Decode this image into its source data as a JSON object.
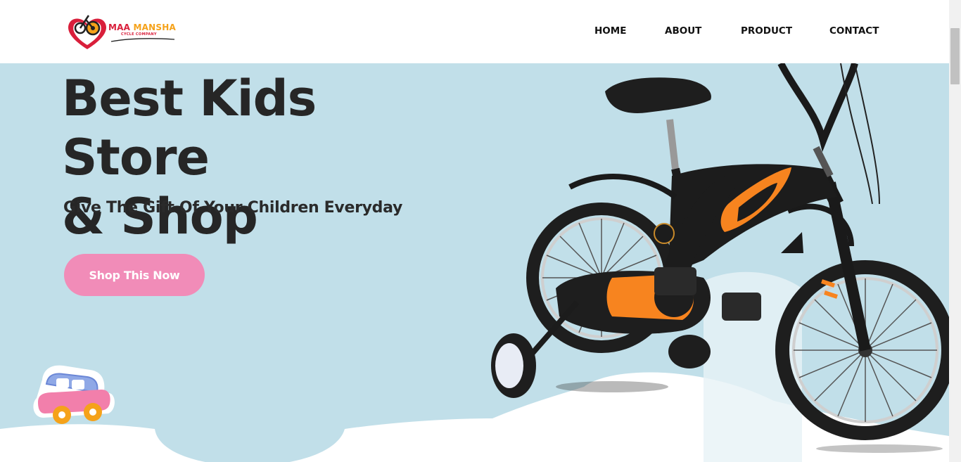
{
  "brand": {
    "name_part1": "MAA",
    "name_part2": "MANSHA",
    "tagline": "CYCLE COMPANY",
    "logo_icon": "bicycle-heart-logo"
  },
  "nav": {
    "items": [
      {
        "label": "HOME"
      },
      {
        "label": "ABOUT"
      },
      {
        "label": "PRODUCT"
      },
      {
        "label": "CONTACT"
      }
    ]
  },
  "hero": {
    "headline_line1": "Best Kids Store",
    "headline_line2": "& Shop",
    "subheadline": "Give The Gift Of Your Children Everyday",
    "cta_label": "Shop This Now",
    "image": "kids-bicycle-with-training-wheels",
    "decoration": "toy-car-icon"
  },
  "colors": {
    "hero_bg": "#c1dfe9",
    "cta_bg": "#f18cb8",
    "heading": "#262626",
    "brand_red": "#d91f3b",
    "brand_orange": "#f5a21a",
    "bike_accent": "#f7841f"
  }
}
